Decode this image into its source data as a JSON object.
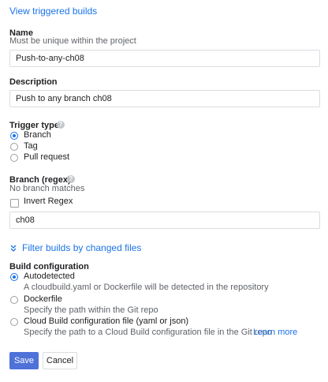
{
  "header": {
    "view_triggered_builds": "View triggered builds"
  },
  "name": {
    "label": "Name",
    "hint": "Must be unique within the project",
    "value": "Push-to-any-ch08"
  },
  "description": {
    "label": "Description",
    "value": "Push to any branch ch08"
  },
  "trigger_type": {
    "label": "Trigger type",
    "options": [
      "Branch",
      "Tag",
      "Pull request"
    ],
    "selected": "Branch"
  },
  "branch": {
    "label": "Branch (regex)",
    "hint": "No branch matches",
    "invert_label": "Invert Regex",
    "invert_checked": false,
    "value": "ch08"
  },
  "filter": {
    "label": "Filter builds by changed files"
  },
  "build_config": {
    "label": "Build configuration",
    "options": [
      {
        "label": "Autodetected",
        "hint": "A cloudbuild.yaml or Dockerfile will be detected in the repository"
      },
      {
        "label": "Dockerfile",
        "hint": "Specify the path within the Git repo"
      },
      {
        "label": "Cloud Build configuration file (yaml or json)",
        "hint": "Specify the path to a Cloud Build configuration file in the Git repo"
      }
    ],
    "selected": "Autodetected",
    "learn_more": "Learn more"
  },
  "actions": {
    "save": "Save",
    "cancel": "Cancel"
  },
  "colors": {
    "accent": "#1a73e8",
    "primary_button": "#4f72d9"
  }
}
